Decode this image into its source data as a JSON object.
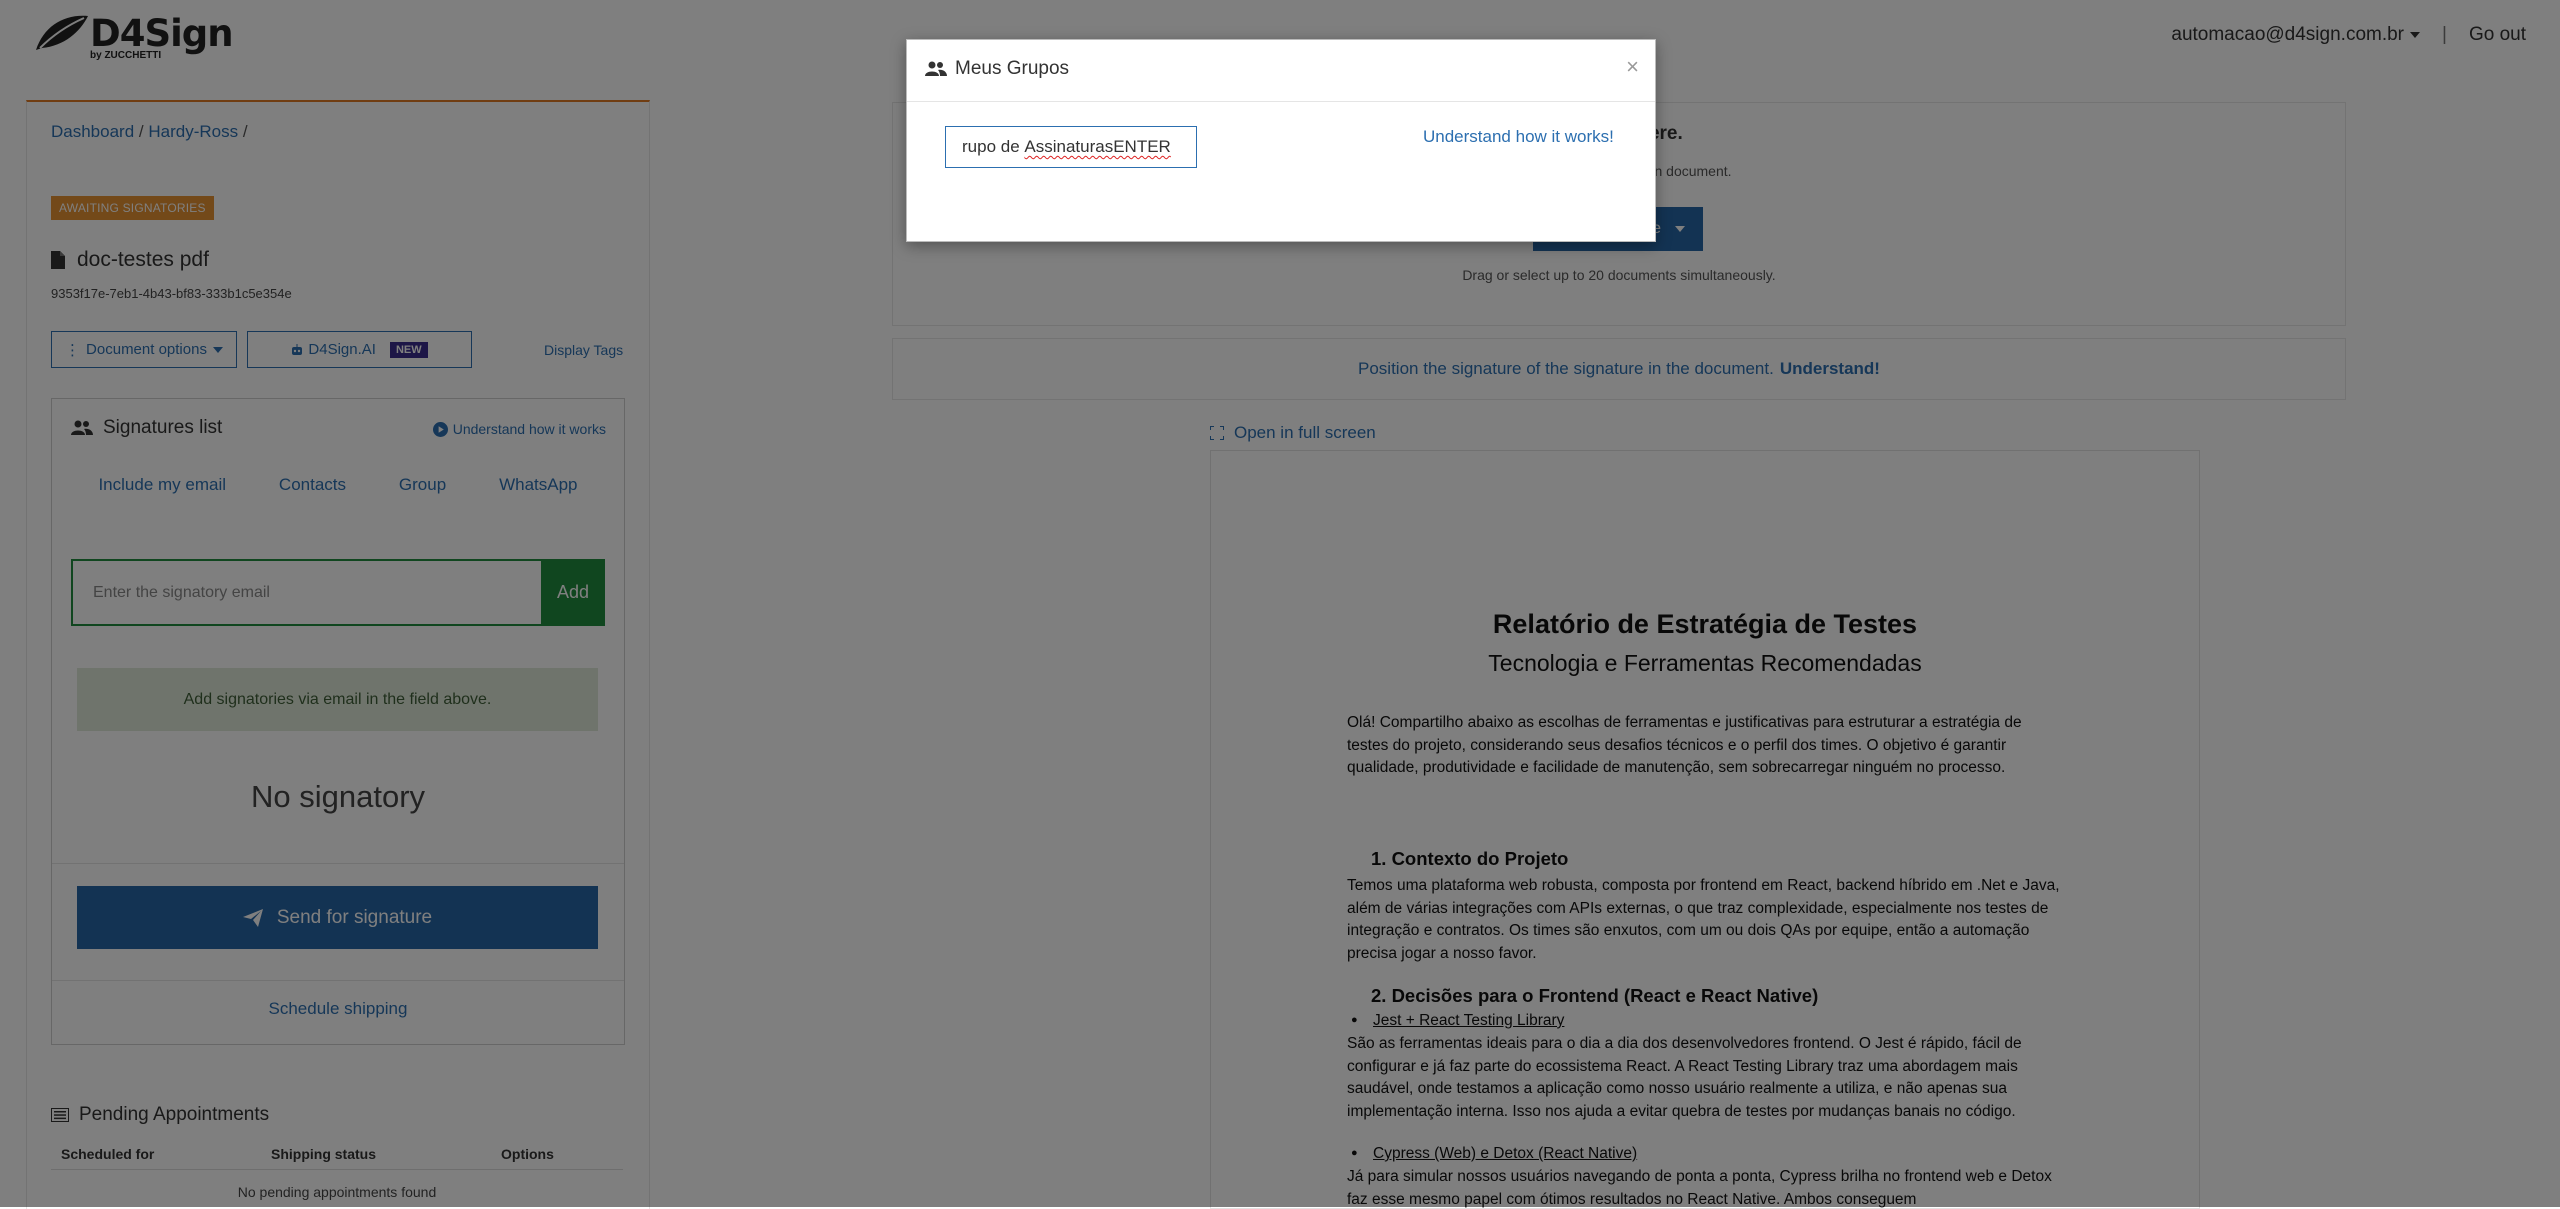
{
  "header": {
    "logo_text": "D4Sign",
    "logo_sub": "by ZUCCHETTI",
    "user_email": "automacao@d4sign.com.br",
    "separator": "|",
    "logout_label": "Go out"
  },
  "left": {
    "breadcrumb": {
      "item1": "Dashboard",
      "sep1": " / ",
      "item2": "Hardy-Ross",
      "sep2": " /"
    },
    "status_badge": "AWAITING SIGNATORIES",
    "doc_name": "doc-testes pdf",
    "doc_id": "9353f17e-7eb1-4b43-bf83-333b1c5e354e",
    "document_options_label": "Document options",
    "ai_label": "D4Sign.AI",
    "ai_badge": "NEW",
    "display_tags_label": "Display Tags",
    "signatures": {
      "title": "Signatures list",
      "help_label": "Understand how it works",
      "tabs": [
        "Include my email",
        "Contacts",
        "Group",
        "WhatsApp"
      ],
      "email_placeholder": "Enter the signatory email",
      "add_label": "Add",
      "hint": "Add signatories via email in the field above.",
      "empty_label": "No signatory",
      "send_label": "Send for signature",
      "schedule_label": "Schedule shipping"
    },
    "pending": {
      "title": "Pending Appointments",
      "columns": [
        "Scheduled for",
        "Shipping status",
        "Options"
      ],
      "empty_label": "No pending appointments found"
    }
  },
  "right": {
    "upload_title": "ents here.",
    "upload_sub": "of the main document.",
    "upload_button": "e",
    "upload_drag": "Drag or select up to 20 documents simultaneously.",
    "position_text": "Position the signature of the signature in the document.",
    "position_link": "Understand!",
    "fullscreen_label": "Open in full screen"
  },
  "document": {
    "title": "Relatório de Estratégia de Testes",
    "subtitle": "Tecnologia e Ferramentas Recomendadas",
    "intro": "Olá! Compartilho abaixo as escolhas de ferramentas e justificativas para estruturar a estratégia de testes do projeto, considerando seus desafios técnicos e o perfil dos times. O objetivo é garantir qualidade, produtividade e facilidade de manutenção, sem sobrecarregar ninguém no processo.",
    "section1_title": "1.  Contexto do Projeto",
    "section1_text": "Temos uma plataforma web robusta, composta por frontend em React, backend híbrido em .Net e Java, além de várias integrações com APIs externas, o que traz complexidade, especialmente nos testes de integração e contratos. Os times são enxutos, com um ou dois QAs por equipe, então a automação precisa jogar a nosso favor.",
    "section2_title": "2.  Decisões para o Frontend (React e React Native)",
    "bullet1": "Jest + React Testing Library",
    "bullet1_text": "São as ferramentas ideais para o dia a dia dos desenvolvedores frontend. O Jest é rápido, fácil de configurar e já faz parte do ecossistema React. A React Testing Library traz uma abordagem mais saudável, onde testamos a aplicação como nosso usuário realmente a utiliza, e não apenas sua implementação interna. Isso nos ajuda a evitar quebra de testes por mudanças banais no código.",
    "bullet2": "Cypress (Web) e Detox (React Native)",
    "bullet2_text": "Já para simular nossos usuários navegando de ponta a ponta, Cypress brilha no frontend web e Detox faz esse mesmo papel com ótimos resultados no React Native. Ambos conseguem"
  },
  "modal": {
    "title": "Meus Grupos",
    "close": "×",
    "input_prefix": "rupo de ",
    "input_misspelled": "AssinaturasENTER",
    "help_label": "Understand how it works!"
  }
}
